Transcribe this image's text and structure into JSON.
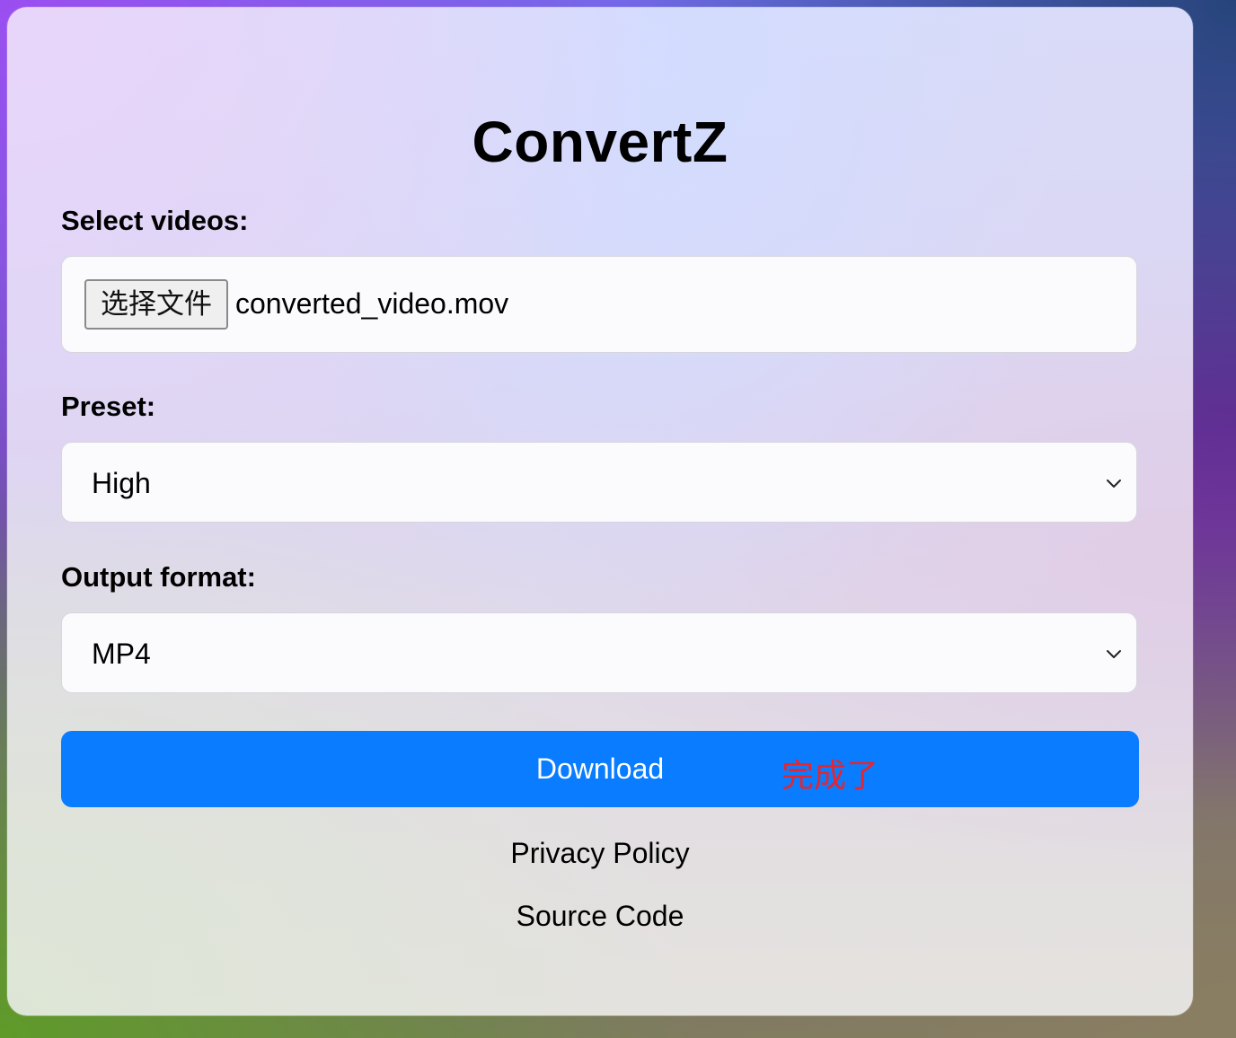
{
  "app": {
    "title": "ConvertZ"
  },
  "form": {
    "videos_label": "Select videos:",
    "file_button_label": "选择文件",
    "file_name": "converted_video.mov",
    "preset_label": "Preset:",
    "preset_value": "High",
    "format_label": "Output format:",
    "format_value": "MP4",
    "download_label": "Download",
    "annotation": "完成了"
  },
  "links": {
    "privacy": "Privacy Policy",
    "source": "Source Code"
  },
  "colors": {
    "accent": "#0a7cff",
    "annotation": "#e8242c"
  }
}
